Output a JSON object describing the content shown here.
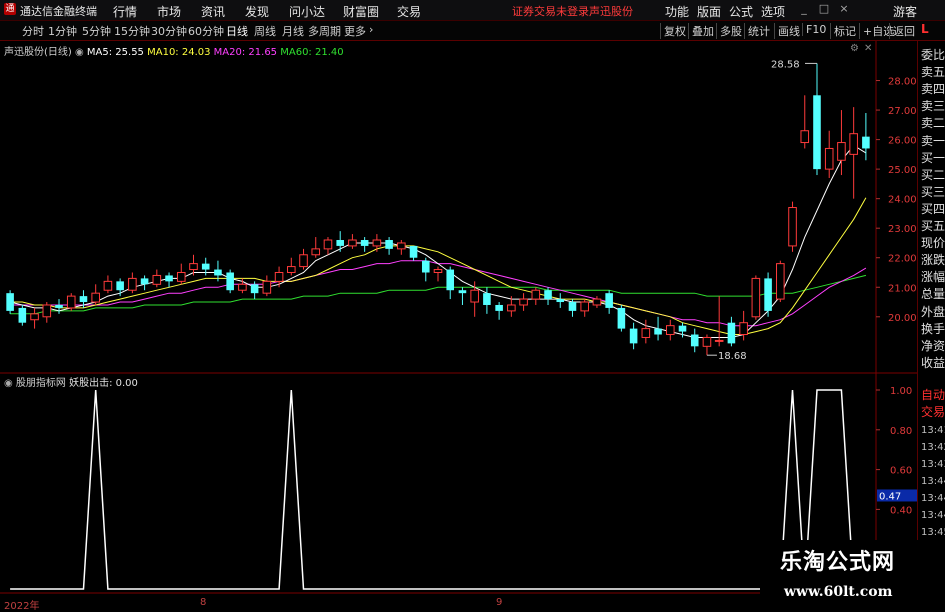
{
  "app": {
    "title": "通达信金融终端",
    "menus": [
      "行情",
      "市场",
      "资讯",
      "发现",
      "问小达",
      "财富圈",
      "交易"
    ],
    "notice": "证券交易未登录",
    "stock_link": "声迅股份",
    "right_menus": [
      "功能",
      "版面",
      "公式",
      "选项"
    ],
    "guest": "游客",
    "window_buttons": [
      "_",
      "□",
      "×"
    ]
  },
  "toolbar": {
    "periods": [
      "分时",
      "1分钟",
      "5分钟",
      "15分钟",
      "30分钟",
      "60分钟",
      "日线",
      "周线",
      "月线",
      "多周期",
      "更多"
    ],
    "active_period": "日线",
    "right_buttons": [
      "复权",
      "叠加",
      "多股",
      "统计",
      "画线",
      "F10",
      "标记",
      "+自选",
      "返回"
    ],
    "mode_flag": "L"
  },
  "main_chart": {
    "title": "声迅股份(日线)",
    "ma_labels": [
      {
        "text": "MA5: 25.55",
        "color": "#ffffff"
      },
      {
        "text": "MA10: 24.03",
        "color": "#ffff40"
      },
      {
        "text": "MA20: 21.65",
        "color": "#ff40ff"
      },
      {
        "text": "MA60: 21.40",
        "color": "#30e030"
      }
    ],
    "high_label": "28.58",
    "low_label": "18.68"
  },
  "indicator": {
    "title": "股朋指标网",
    "line_label": "妖股出击: 0.00",
    "current_value": "0.47"
  },
  "right_panel": {
    "labels": [
      "委比",
      "卖五",
      "卖四",
      "卖三",
      "卖二",
      "卖一",
      "买一",
      "买二",
      "买三",
      "买四",
      "买五",
      "现价",
      "涨跌",
      "涨幅",
      "总量",
      "外盘",
      "换手",
      "净资",
      "收益"
    ],
    "extra": [
      "自动",
      "交易"
    ],
    "times": [
      "13:41",
      "13:42",
      "13:43",
      "13:44",
      "13:44",
      "13:44",
      "13:45",
      "13:45"
    ]
  },
  "date_axis": [
    "2022年",
    "8",
    "9"
  ],
  "watermark": {
    "line1": "乐淘公式网",
    "line2": "www.60lt.com"
  },
  "chart_data": [
    {
      "type": "candlestick",
      "title": "声迅股份(日线)",
      "ylim": [
        18.3,
        29.0
      ],
      "yticks": [
        20.0,
        21.0,
        22.0,
        23.0,
        24.0,
        25.0,
        26.0,
        27.0,
        28.0
      ],
      "up_color": "#ff3b3b",
      "down_color": "#54ffff",
      "candles": [
        [
          20.8,
          20.2,
          20.9,
          20.1
        ],
        [
          20.3,
          19.8,
          20.4,
          19.7
        ],
        [
          19.9,
          20.1,
          20.3,
          19.6
        ],
        [
          20.0,
          20.4,
          20.5,
          19.8
        ],
        [
          20.4,
          20.3,
          20.6,
          20.1
        ],
        [
          20.3,
          20.7,
          20.8,
          20.2
        ],
        [
          20.7,
          20.5,
          20.9,
          20.3
        ],
        [
          20.5,
          20.8,
          21.1,
          20.4
        ],
        [
          20.9,
          21.2,
          21.4,
          20.8
        ],
        [
          21.2,
          20.9,
          21.3,
          20.7
        ],
        [
          20.9,
          21.3,
          21.5,
          20.8
        ],
        [
          21.3,
          21.1,
          21.4,
          20.9
        ],
        [
          21.1,
          21.4,
          21.6,
          21.0
        ],
        [
          21.4,
          21.2,
          21.5,
          21.0
        ],
        [
          21.2,
          21.5,
          21.8,
          21.1
        ],
        [
          21.6,
          21.8,
          22.1,
          21.4
        ],
        [
          21.8,
          21.6,
          22.0,
          21.4
        ],
        [
          21.6,
          21.4,
          21.9,
          21.2
        ],
        [
          21.5,
          20.9,
          21.6,
          20.8
        ],
        [
          20.9,
          21.1,
          21.3,
          20.8
        ],
        [
          21.1,
          20.8,
          21.2,
          20.6
        ],
        [
          20.8,
          21.2,
          21.4,
          20.7
        ],
        [
          21.2,
          21.5,
          21.7,
          21.0
        ],
        [
          21.5,
          21.7,
          22.0,
          21.4
        ],
        [
          21.7,
          22.1,
          22.3,
          21.6
        ],
        [
          22.1,
          22.3,
          22.7,
          22.0
        ],
        [
          22.3,
          22.6,
          22.7,
          22.1
        ],
        [
          22.6,
          22.4,
          22.9,
          22.2
        ],
        [
          22.4,
          22.6,
          22.8,
          22.3
        ],
        [
          22.6,
          22.4,
          22.7,
          22.2
        ],
        [
          22.4,
          22.6,
          22.8,
          22.2
        ],
        [
          22.6,
          22.3,
          22.7,
          22.1
        ],
        [
          22.3,
          22.5,
          22.6,
          22.1
        ],
        [
          22.4,
          22.0,
          22.4,
          21.9
        ],
        [
          21.9,
          21.5,
          22.0,
          21.2
        ],
        [
          21.5,
          21.6,
          21.7,
          21.2
        ],
        [
          21.6,
          20.9,
          21.7,
          20.6
        ],
        [
          20.9,
          20.8,
          21.0,
          20.4
        ],
        [
          20.5,
          20.9,
          21.2,
          20.0
        ],
        [
          20.8,
          20.4,
          21.0,
          20.1
        ],
        [
          20.4,
          20.2,
          20.5,
          19.9
        ],
        [
          20.2,
          20.4,
          20.7,
          20.0
        ],
        [
          20.4,
          20.6,
          20.8,
          20.2
        ],
        [
          20.6,
          20.9,
          21.0,
          20.4
        ],
        [
          20.9,
          20.6,
          21.0,
          20.4
        ],
        [
          20.6,
          20.5,
          20.8,
          20.3
        ],
        [
          20.5,
          20.2,
          20.6,
          20.0
        ],
        [
          20.2,
          20.5,
          20.6,
          20.0
        ],
        [
          20.4,
          20.6,
          20.7,
          20.3
        ],
        [
          20.8,
          20.3,
          20.9,
          20.1
        ],
        [
          20.3,
          19.6,
          20.4,
          19.5
        ],
        [
          19.6,
          19.1,
          19.8,
          18.9
        ],
        [
          19.3,
          19.6,
          19.9,
          19.1
        ],
        [
          19.6,
          19.4,
          20.0,
          19.2
        ],
        [
          19.4,
          19.7,
          19.9,
          19.2
        ],
        [
          19.7,
          19.5,
          19.8,
          19.3
        ],
        [
          19.4,
          19.0,
          19.6,
          18.8
        ],
        [
          19.0,
          19.3,
          19.4,
          18.7
        ],
        [
          19.2,
          19.2,
          20.7,
          19.0
        ],
        [
          19.8,
          19.1,
          20.0,
          19.0
        ],
        [
          19.4,
          19.8,
          20.2,
          19.2
        ],
        [
          20.0,
          21.3,
          21.4,
          19.9
        ],
        [
          21.3,
          20.2,
          21.5,
          20.0
        ],
        [
          20.6,
          21.8,
          21.9,
          20.5
        ],
        [
          22.4,
          23.7,
          23.9,
          22.2
        ],
        [
          25.9,
          26.3,
          27.5,
          25.7
        ],
        [
          27.5,
          25.0,
          28.58,
          24.8
        ],
        [
          25.0,
          25.7,
          26.3,
          24.7
        ],
        [
          25.3,
          25.9,
          27.0,
          24.8
        ],
        [
          25.5,
          26.2,
          27.1,
          24.0
        ],
        [
          26.1,
          25.7,
          26.9,
          25.3
        ]
      ],
      "ma5": [
        20.5,
        20.4,
        20.3,
        20.3,
        20.2,
        20.3,
        20.4,
        20.5,
        20.7,
        20.8,
        21.0,
        21.1,
        21.2,
        21.3,
        21.3,
        21.5,
        21.5,
        21.5,
        21.3,
        21.2,
        21.0,
        21.0,
        21.1,
        21.3,
        21.5,
        21.9,
        22.1,
        22.3,
        22.5,
        22.5,
        22.5,
        22.5,
        22.4,
        22.3,
        22.1,
        21.8,
        21.5,
        21.2,
        21.0,
        20.8,
        20.7,
        20.6,
        20.6,
        20.6,
        20.6,
        20.6,
        20.5,
        20.5,
        20.5,
        20.4,
        20.2,
        19.9,
        19.7,
        19.6,
        19.5,
        19.4,
        19.3,
        19.3,
        19.3,
        19.3,
        19.4,
        19.8,
        20.2,
        20.7,
        21.6,
        22.7,
        23.6,
        24.5,
        25.3,
        25.8,
        25.55
      ],
      "ma10": [
        20.5,
        20.5,
        20.4,
        20.4,
        20.3,
        20.3,
        20.3,
        20.4,
        20.5,
        20.6,
        20.7,
        20.8,
        20.9,
        21.0,
        21.1,
        21.2,
        21.3,
        21.3,
        21.3,
        21.3,
        21.3,
        21.2,
        21.2,
        21.2,
        21.3,
        21.4,
        21.6,
        21.8,
        22.0,
        22.1,
        22.3,
        22.4,
        22.4,
        22.4,
        22.3,
        22.2,
        22.0,
        21.8,
        21.6,
        21.4,
        21.2,
        21.0,
        20.9,
        20.8,
        20.7,
        20.6,
        20.6,
        20.6,
        20.5,
        20.5,
        20.4,
        20.3,
        20.2,
        20.1,
        20.0,
        19.8,
        19.7,
        19.6,
        19.5,
        19.4,
        19.4,
        19.5,
        19.6,
        19.8,
        20.3,
        20.9,
        21.5,
        22.1,
        22.7,
        23.3,
        24.03
      ],
      "ma20": [
        20.4,
        20.4,
        20.4,
        20.4,
        20.4,
        20.4,
        20.4,
        20.4,
        20.4,
        20.5,
        20.5,
        20.6,
        20.7,
        20.8,
        20.8,
        20.9,
        21.0,
        21.0,
        21.1,
        21.1,
        21.1,
        21.1,
        21.2,
        21.2,
        21.3,
        21.4,
        21.5,
        21.6,
        21.6,
        21.7,
        21.8,
        21.8,
        21.9,
        21.9,
        21.9,
        21.8,
        21.8,
        21.7,
        21.6,
        21.5,
        21.4,
        21.3,
        21.2,
        21.1,
        21.0,
        20.9,
        20.8,
        20.7,
        20.6,
        20.5,
        20.4,
        20.3,
        20.2,
        20.1,
        20.0,
        19.9,
        19.9,
        19.8,
        19.8,
        19.7,
        19.7,
        19.7,
        19.8,
        19.9,
        20.1,
        20.4,
        20.7,
        21.0,
        21.2,
        21.4,
        21.65
      ],
      "ma60": [
        20.1,
        20.1,
        20.1,
        20.2,
        20.2,
        20.2,
        20.2,
        20.3,
        20.3,
        20.3,
        20.3,
        20.4,
        20.4,
        20.4,
        20.4,
        20.5,
        20.5,
        20.5,
        20.5,
        20.6,
        20.6,
        20.6,
        20.6,
        20.6,
        20.7,
        20.7,
        20.7,
        20.8,
        20.8,
        20.8,
        20.8,
        20.9,
        20.9,
        20.9,
        20.9,
        21.0,
        21.0,
        21.0,
        21.0,
        21.0,
        21.0,
        21.0,
        21.0,
        21.0,
        20.9,
        20.9,
        20.9,
        20.9,
        20.9,
        20.9,
        20.8,
        20.8,
        20.8,
        20.8,
        20.8,
        20.8,
        20.8,
        20.7,
        20.7,
        20.7,
        20.7,
        20.7,
        20.8,
        20.8,
        20.8,
        20.9,
        21.0,
        21.1,
        21.2,
        21.3,
        21.4
      ]
    },
    {
      "type": "line",
      "title": "股朋指标网",
      "series_name": "妖股出击",
      "ylim": [
        0.0,
        1.0
      ],
      "yticks": [
        1.0,
        0.8,
        0.6,
        0.4,
        0.2
      ],
      "pulses": [
        {
          "center": 7,
          "value": 1.0
        },
        {
          "center": 23,
          "value": 1.0
        },
        {
          "center": 64,
          "value": 1.0
        },
        {
          "start": 66,
          "end": 68,
          "value": 1.0
        }
      ],
      "last_value": 0.0
    }
  ]
}
